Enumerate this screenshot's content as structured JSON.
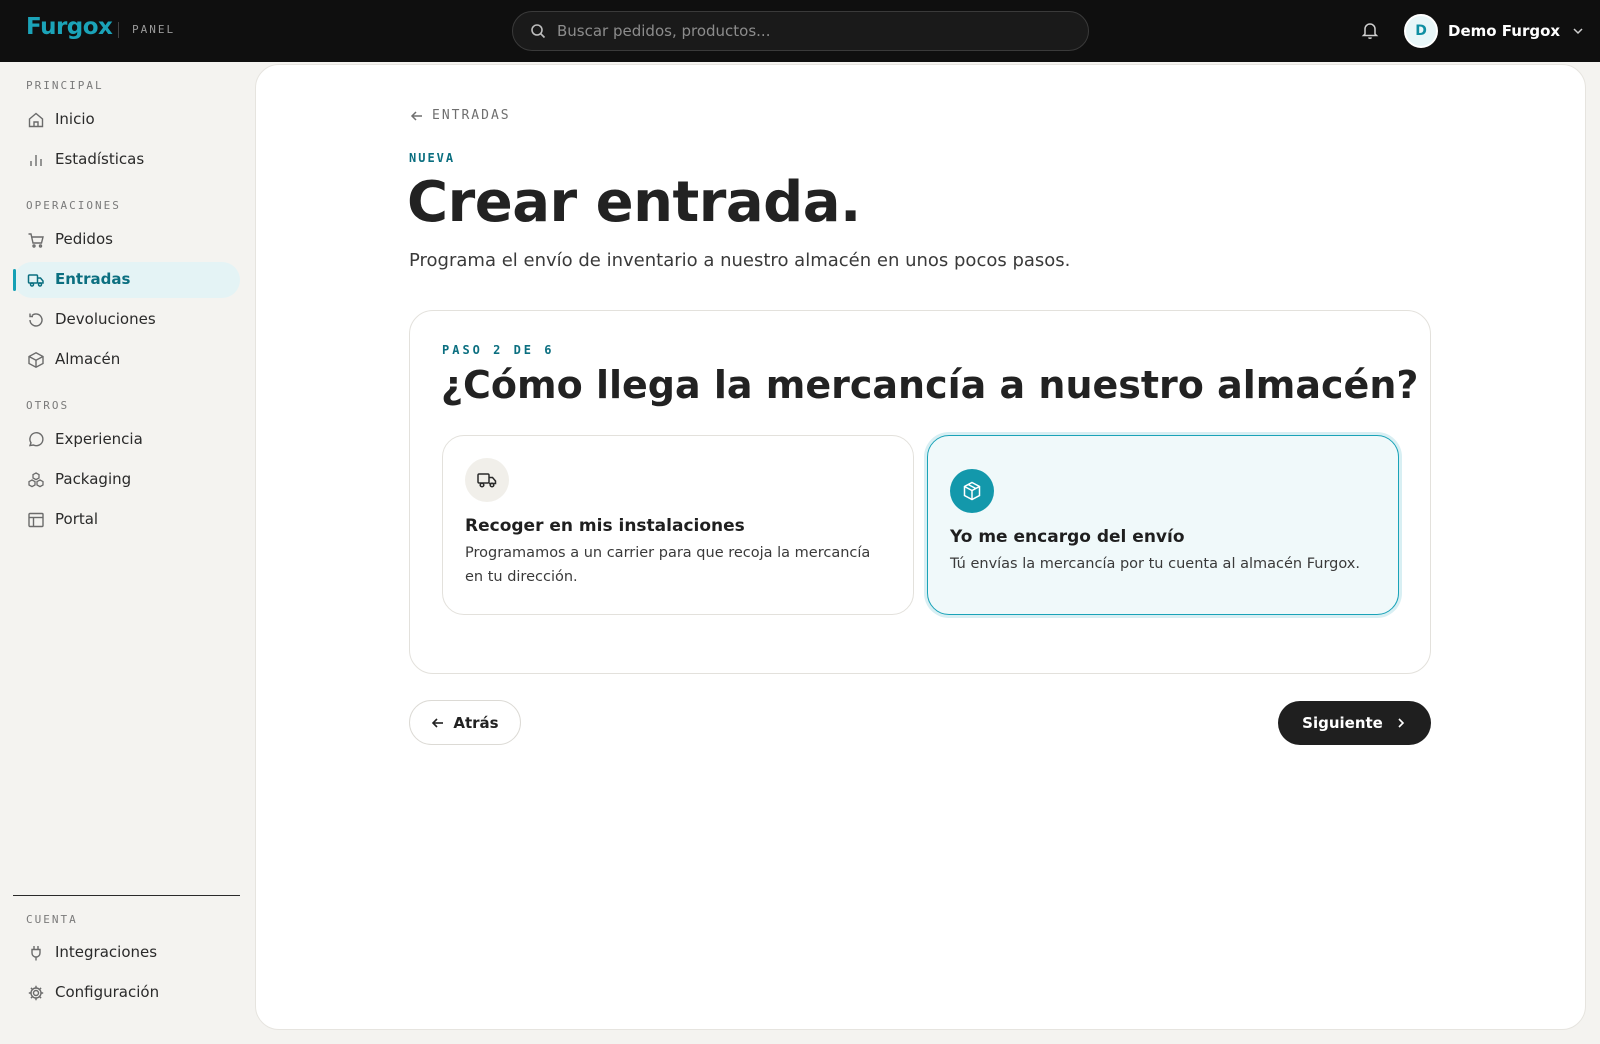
{
  "topbar": {
    "logo": "Furgox",
    "logo_tag": "PANEL",
    "search_placeholder": "Buscar pedidos, productos...",
    "user_initial": "D",
    "user_name": "Demo Furgox"
  },
  "sidebar": {
    "sections": {
      "principal": "PRINCIPAL",
      "operaciones": "OPERACIONES",
      "otros": "OTROS",
      "cuenta": "CUENTA"
    },
    "items": [
      {
        "label": "Inicio",
        "icon": "home-icon"
      },
      {
        "label": "Estadísticas",
        "icon": "bar-chart-icon"
      },
      {
        "label": "Pedidos",
        "icon": "cart-icon"
      },
      {
        "label": "Entradas",
        "icon": "truck-icon",
        "active": true
      },
      {
        "label": "Devoluciones",
        "icon": "return-icon"
      },
      {
        "label": "Almacén",
        "icon": "box-icon"
      },
      {
        "label": "Experiencia",
        "icon": "chat-icon"
      },
      {
        "label": "Packaging",
        "icon": "packages-icon"
      },
      {
        "label": "Portal",
        "icon": "layout-icon"
      },
      {
        "label": "Integraciones",
        "icon": "plug-icon"
      },
      {
        "label": "Configuración",
        "icon": "gear-icon"
      }
    ]
  },
  "main": {
    "back_label": "ENTRADAS",
    "eyebrow": "NUEVA",
    "title": "Crear entrada.",
    "subtitle": "Programa el envío de inventario a nuestro almacén en unos pocos pasos.",
    "step": {
      "label": "PASO 2 DE 6",
      "title": "¿Cómo llega la mercancía a nuestro almacén?",
      "options": [
        {
          "title": "Recoger en mis instalaciones",
          "description": "Programamos a un carrier para que recoja la mercancía en tu dirección.",
          "icon": "truck-icon",
          "selected": false
        },
        {
          "title": "Yo me encargo del envío",
          "description": "Tú envías la mercancía por tu cuenta al almacén Furgox.",
          "icon": "package-icon",
          "selected": true
        }
      ]
    },
    "back_button": "Atrás",
    "next_button": "Siguiente"
  },
  "colors": {
    "accent": "#1398ab",
    "accent_dark": "#0b6f80",
    "topbar": "#0f0f0f",
    "primary_button": "#1f1f1f"
  }
}
